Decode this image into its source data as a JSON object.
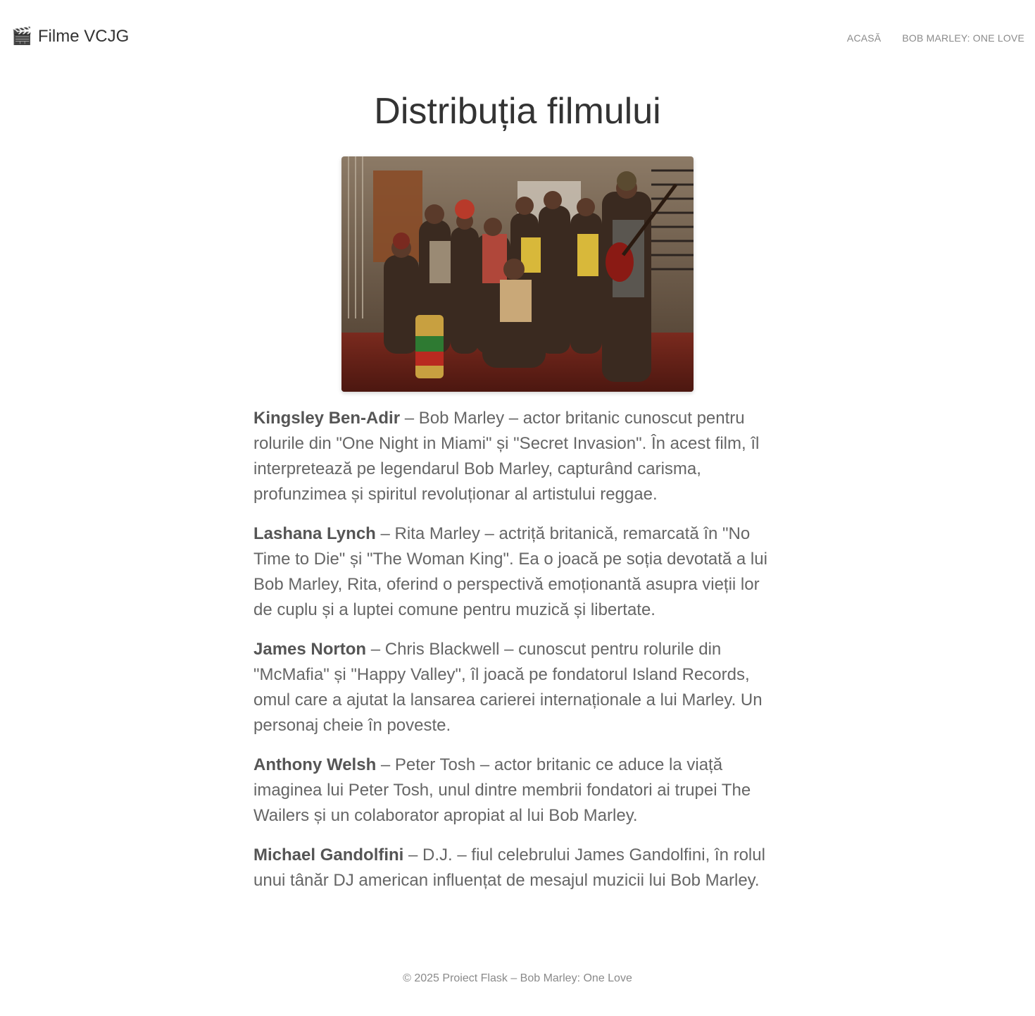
{
  "header": {
    "brand_icon": "🎬",
    "brand_text": "Filme VCJG",
    "nav": [
      {
        "label": "ACASĂ"
      },
      {
        "label": "BOB MARLEY: ONE LOVE"
      }
    ]
  },
  "main": {
    "title": "Distribuția filmului",
    "photo_icon": "cast-photo",
    "cast": [
      {
        "name": "Kingsley Ben-Adir",
        "text": " – Bob Marley – actor britanic cunoscut pentru rolurile din \"One Night in Miami\" și \"Secret Invasion\". În acest film, îl interpretează pe legendarul Bob Marley, capturând carisma, profunzimea și spiritul revoluționar al artistului reggae."
      },
      {
        "name": "Lashana Lynch",
        "text": " – Rita Marley – actriță britanică, remarcată în \"No Time to Die\" și \"The Woman King\". Ea o joacă pe soția devotată a lui Bob Marley, Rita, oferind o perspectivă emoționantă asupra vieții lor de cuplu și a luptei comune pentru muzică și libertate."
      },
      {
        "name": "James Norton",
        "text": " – Chris Blackwell – cunoscut pentru rolurile din \"McMafia\" și \"Happy Valley\", îl joacă pe fondatorul Island Records, omul care a ajutat la lansarea carierei internaționale a lui Marley. Un personaj cheie în poveste."
      },
      {
        "name": "Anthony Welsh",
        "text": " – Peter Tosh – actor britanic ce aduce la viață imaginea lui Peter Tosh, unul dintre membrii fondatori ai trupei The Wailers și un colaborator apropiat al lui Bob Marley."
      },
      {
        "name": "Michael Gandolfini",
        "text": " – D.J. – fiul celebrului James Gandolfini, în rolul unui tânăr DJ american influențat de mesajul muzicii lui Bob Marley."
      }
    ]
  },
  "footer": {
    "text": "© 2025 Proiect Flask – Bob Marley: One Love"
  }
}
